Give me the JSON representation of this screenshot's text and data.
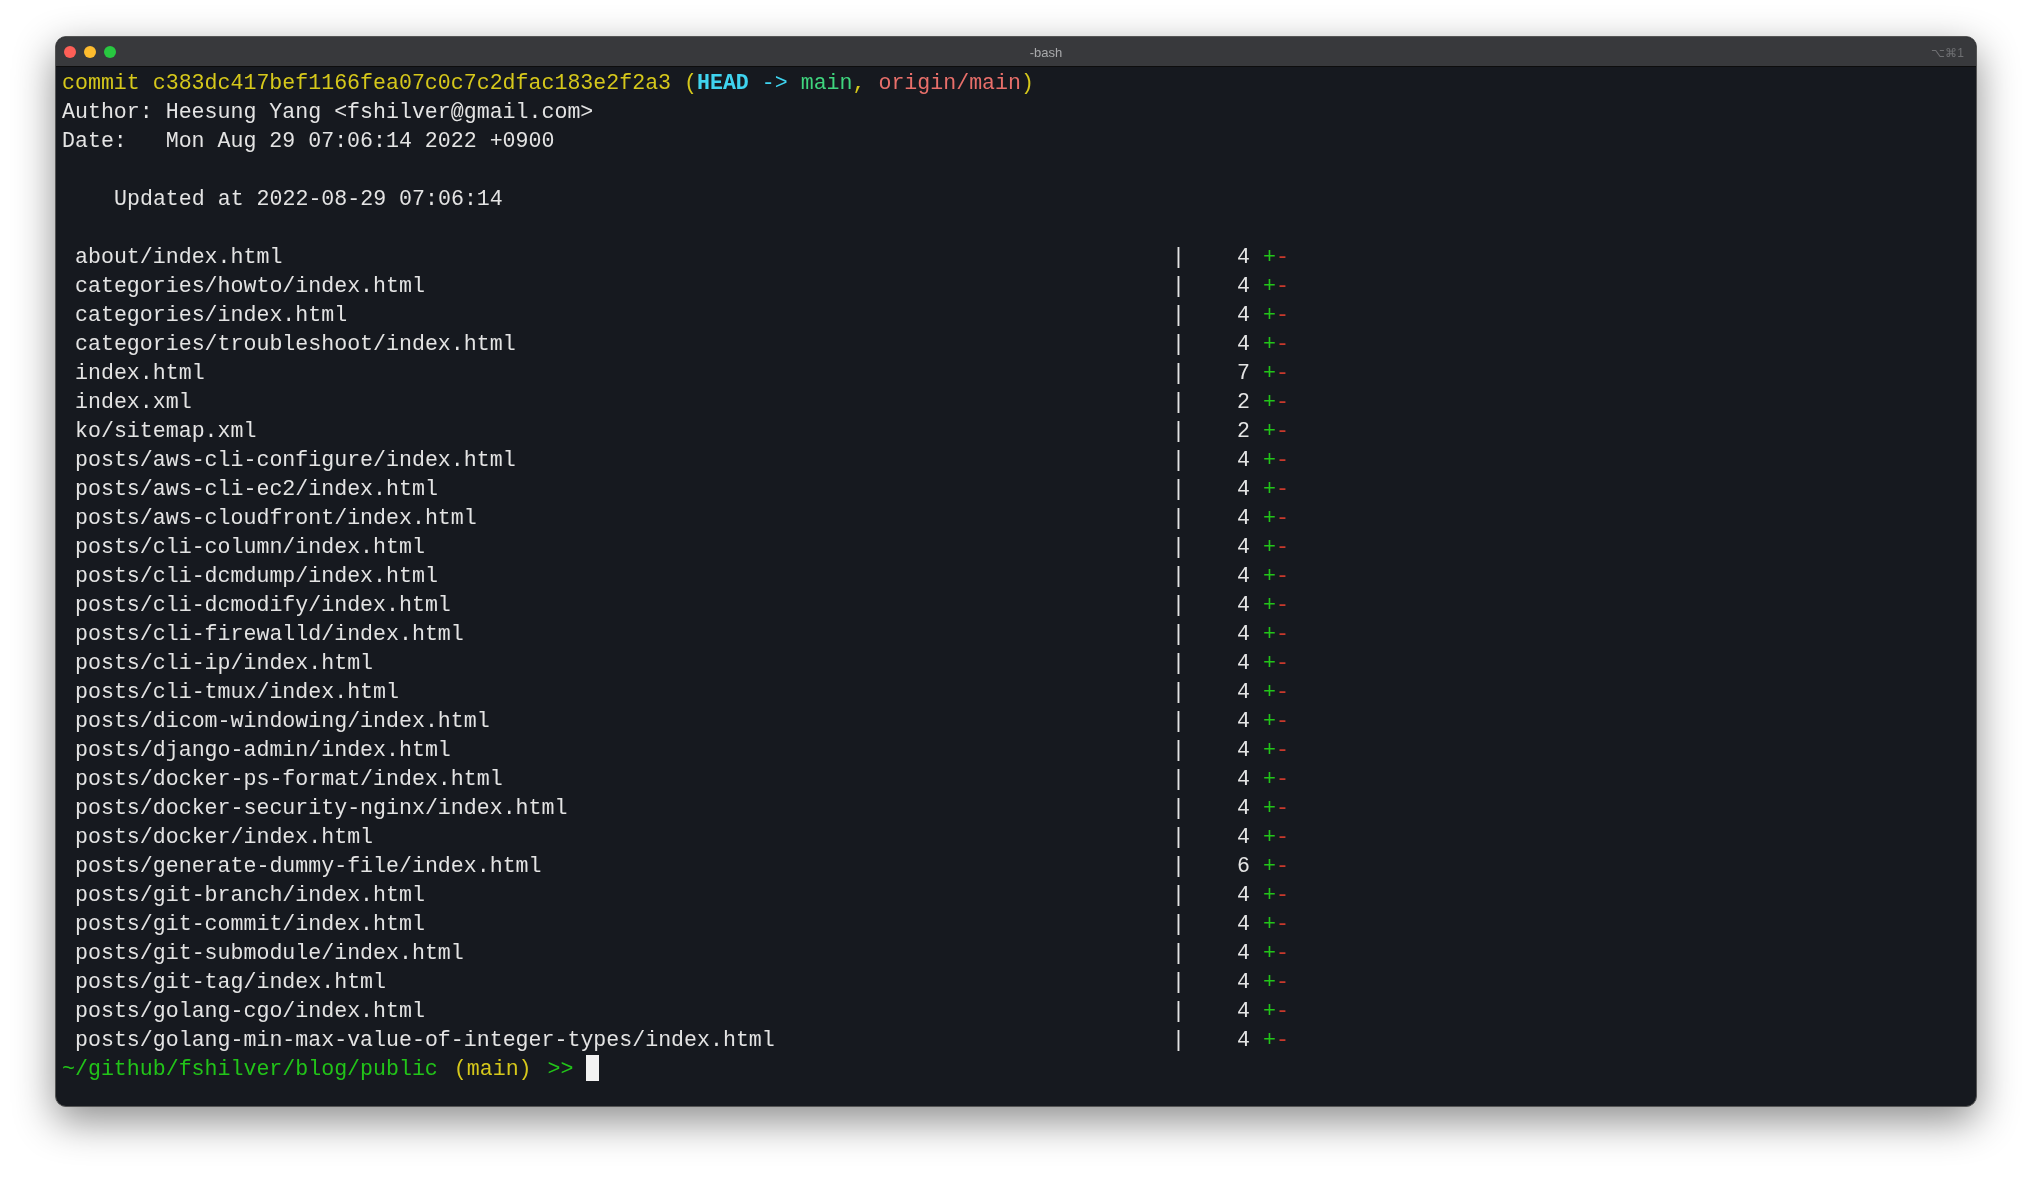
{
  "window": {
    "title": "-bash",
    "shortcut": "⌥⌘1"
  },
  "commit": {
    "label": "commit",
    "hash": "c383dc417bef1166fea07c0c7c2dfac183e2f2a3",
    "refs": [
      {
        "kind": "punct",
        "text": "("
      },
      {
        "kind": "head",
        "text": "HEAD"
      },
      {
        "kind": "arrow",
        "text": " -> "
      },
      {
        "kind": "branch",
        "text": "main"
      },
      {
        "kind": "punct",
        "text": ", "
      },
      {
        "kind": "remote",
        "text": "origin/main"
      },
      {
        "kind": "punct",
        "text": ")"
      }
    ]
  },
  "author": "Author: Heesung Yang <fshilver@gmail.com>",
  "date": "Date:   Mon Aug 29 07:06:14 2022 +0900",
  "message": "Updated at 2022-08-29 07:06:14",
  "files": [
    {
      "path": "about/index.html",
      "separator": "|",
      "count": "4",
      "added": "+",
      "removed": "-"
    },
    {
      "path": "categories/howto/index.html",
      "separator": "|",
      "count": "4",
      "added": "+",
      "removed": "-"
    },
    {
      "path": "categories/index.html",
      "separator": "|",
      "count": "4",
      "added": "+",
      "removed": "-"
    },
    {
      "path": "categories/troubleshoot/index.html",
      "separator": "|",
      "count": "4",
      "added": "+",
      "removed": "-"
    },
    {
      "path": "index.html",
      "separator": "|",
      "count": "7",
      "added": "+",
      "removed": "-"
    },
    {
      "path": "index.xml",
      "separator": "|",
      "count": "2",
      "added": "+",
      "removed": "-"
    },
    {
      "path": "ko/sitemap.xml",
      "separator": "|",
      "count": "2",
      "added": "+",
      "removed": "-"
    },
    {
      "path": "posts/aws-cli-configure/index.html",
      "separator": "|",
      "count": "4",
      "added": "+",
      "removed": "-"
    },
    {
      "path": "posts/aws-cli-ec2/index.html",
      "separator": "|",
      "count": "4",
      "added": "+",
      "removed": "-"
    },
    {
      "path": "posts/aws-cloudfront/index.html",
      "separator": "|",
      "count": "4",
      "added": "+",
      "removed": "-"
    },
    {
      "path": "posts/cli-column/index.html",
      "separator": "|",
      "count": "4",
      "added": "+",
      "removed": "-"
    },
    {
      "path": "posts/cli-dcmdump/index.html",
      "separator": "|",
      "count": "4",
      "added": "+",
      "removed": "-"
    },
    {
      "path": "posts/cli-dcmodify/index.html",
      "separator": "|",
      "count": "4",
      "added": "+",
      "removed": "-"
    },
    {
      "path": "posts/cli-firewalld/index.html",
      "separator": "|",
      "count": "4",
      "added": "+",
      "removed": "-"
    },
    {
      "path": "posts/cli-ip/index.html",
      "separator": "|",
      "count": "4",
      "added": "+",
      "removed": "-"
    },
    {
      "path": "posts/cli-tmux/index.html",
      "separator": "|",
      "count": "4",
      "added": "+",
      "removed": "-"
    },
    {
      "path": "posts/dicom-windowing/index.html",
      "separator": "|",
      "count": "4",
      "added": "+",
      "removed": "-"
    },
    {
      "path": "posts/django-admin/index.html",
      "separator": "|",
      "count": "4",
      "added": "+",
      "removed": "-"
    },
    {
      "path": "posts/docker-ps-format/index.html",
      "separator": "|",
      "count": "4",
      "added": "+",
      "removed": "-"
    },
    {
      "path": "posts/docker-security-nginx/index.html",
      "separator": "|",
      "count": "4",
      "added": "+",
      "removed": "-"
    },
    {
      "path": "posts/docker/index.html",
      "separator": "|",
      "count": "4",
      "added": "+",
      "removed": "-"
    },
    {
      "path": "posts/generate-dummy-file/index.html",
      "separator": "|",
      "count": "6",
      "added": "+",
      "removed": "-"
    },
    {
      "path": "posts/git-branch/index.html",
      "separator": "|",
      "count": "4",
      "added": "+",
      "removed": "-"
    },
    {
      "path": "posts/git-commit/index.html",
      "separator": "|",
      "count": "4",
      "added": "+",
      "removed": "-"
    },
    {
      "path": "posts/git-submodule/index.html",
      "separator": "|",
      "count": "4",
      "added": "+",
      "removed": "-"
    },
    {
      "path": "posts/git-tag/index.html",
      "separator": "|",
      "count": "4",
      "added": "+",
      "removed": "-"
    },
    {
      "path": "posts/golang-cgo/index.html",
      "separator": "|",
      "count": "4",
      "added": "+",
      "removed": "-"
    },
    {
      "path": "posts/golang-min-max-value-of-integer-types/index.html",
      "separator": "|",
      "count": "4",
      "added": "+",
      "removed": "-"
    }
  ],
  "prompt": {
    "path": "~/github/fshilver/blog/public",
    "branch": "(main)",
    "symbol": ">>"
  }
}
